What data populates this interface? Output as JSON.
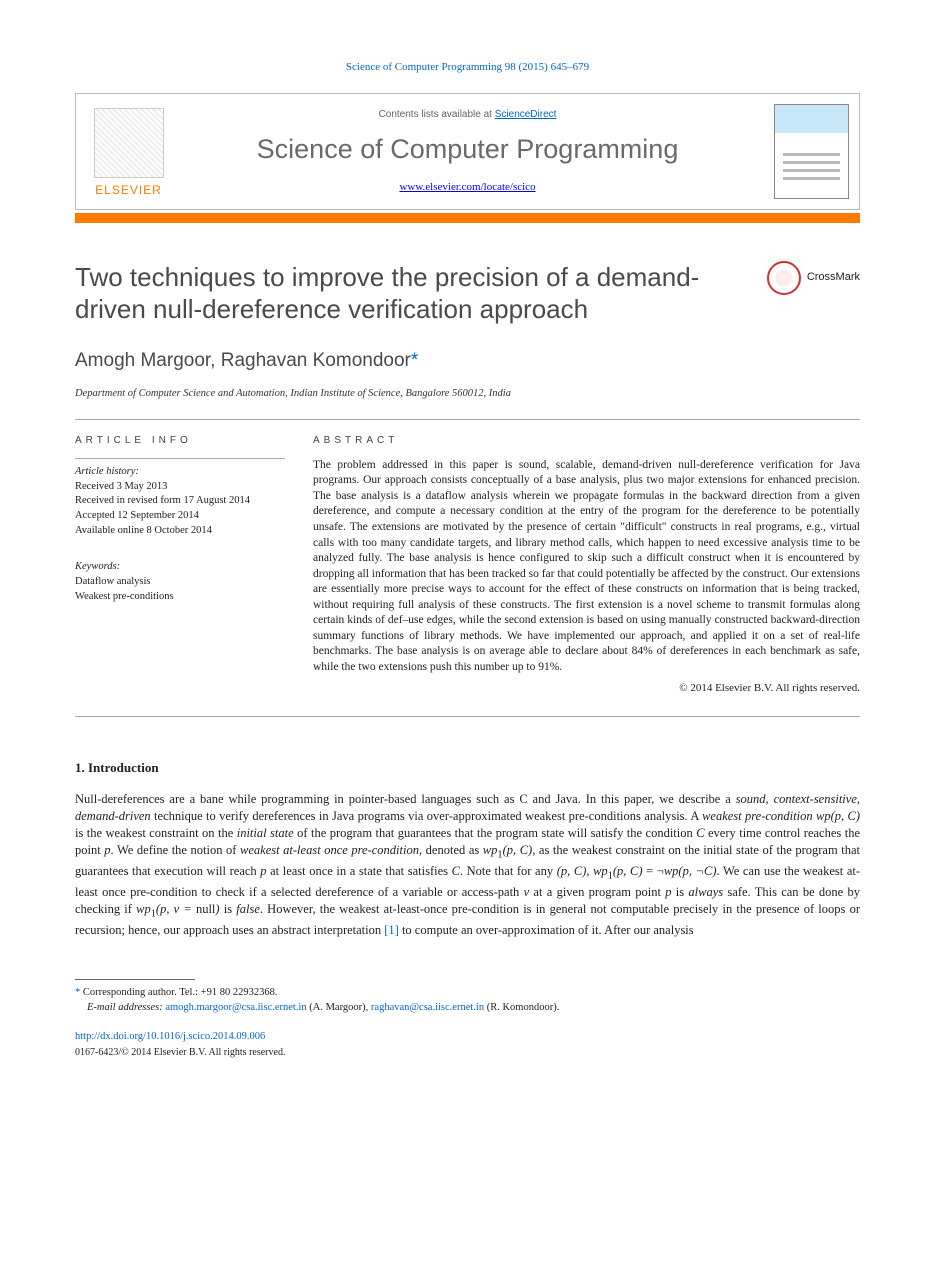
{
  "citation": "Science of Computer Programming 98 (2015) 645–679",
  "header": {
    "contents_line_pre": "Contents lists available at ",
    "contents_link": "ScienceDirect",
    "journal_name": "Science of Computer Programming",
    "journal_url": "www.elsevier.com/locate/scico",
    "publisher_word": "ELSEVIER"
  },
  "crossmark_label": "CrossMark",
  "title": "Two techniques to improve the precision of a demand-driven null-dereference verification approach",
  "authors": "Amogh Margoor, Raghavan Komondoor",
  "author_star": "*",
  "affiliation": "Department of Computer Science and Automation, Indian Institute of Science, Bangalore 560012, India",
  "article_info": {
    "heading": "ARTICLE INFO",
    "history_label": "Article history:",
    "received": "Received 3 May 2013",
    "revised": "Received in revised form 17 August 2014",
    "accepted": "Accepted 12 September 2014",
    "online": "Available online 8 October 2014",
    "keywords_label": "Keywords:",
    "kw1": "Dataflow analysis",
    "kw2": "Weakest pre-conditions"
  },
  "abstract": {
    "heading": "ABSTRACT",
    "text": "The problem addressed in this paper is sound, scalable, demand-driven null-dereference verification for Java programs. Our approach consists conceptually of a base analysis, plus two major extensions for enhanced precision. The base analysis is a dataflow analysis wherein we propagate formulas in the backward direction from a given dereference, and compute a necessary condition at the entry of the program for the dereference to be potentially unsafe. The extensions are motivated by the presence of certain \"difficult\" constructs in real programs, e.g., virtual calls with too many candidate targets, and library method calls, which happen to need excessive analysis time to be analyzed fully. The base analysis is hence configured to skip such a difficult construct when it is encountered by dropping all information that has been tracked so far that could potentially be affected by the construct. Our extensions are essentially more precise ways to account for the effect of these constructs on information that is being tracked, without requiring full analysis of these constructs. The first extension is a novel scheme to transmit formulas along certain kinds of def–use edges, while the second extension is based on using manually constructed backward-direction summary functions of library methods. We have implemented our approach, and applied it on a set of real-life benchmarks. The base analysis is on average able to declare about 84% of dereferences in each benchmark as safe, while the two extensions push this number up to 91%.",
    "copyright": "© 2014 Elsevier B.V. All rights reserved."
  },
  "section1": {
    "heading": "1. Introduction",
    "body_html": "Null-dereferences are a bane while programming in pointer-based languages such as C and Java. In this paper, we describe a <span class='ital'>sound, context-sensitive, demand-driven</span> technique to verify dereferences in Java programs via over-approximated weakest pre-conditions analysis. A <span class='ital'>weakest pre-condition wp(p, C)</span> is the weakest constraint on the <span class='ital'>initial state</span> of the program that guarantees that the program state will satisfy the condition <span class='ital'>C</span> every time control reaches the point <span class='ital'>p</span>. We define the notion of <span class='ital'>weakest at-least once pre-condition</span>, denoted as <span class='ital'>wp</span><sub>1</sub><span class='ital'>(p, C)</span>, as the weakest constraint on the initial state of the program that guarantees that execution will reach <span class='ital'>p</span> at least once in a state that satisfies <span class='ital'>C</span>. Note that for any <span class='ital'>(p, C)</span>, <span class='ital'>wp</span><sub>1</sub><span class='ital'>(p, C)</span> = ¬<span class='ital'>wp(p, ¬C)</span>. We can use the weakest at-least once pre-condition to check if a selected dereference of a variable or access-path <span class='ital'>v</span> at a given program point <span class='ital'>p</span> is <span class='ital'>always</span> safe. This can be done by checking if <span class='ital'>wp</span><sub>1</sub><span class='ital'>(p, v = </span>null<span class='ital'>)</span> is <span class='ital'>false</span>. However, the weakest at-least-once pre-condition is in general not computable precisely in the presence of loops or recursion; hence, our approach uses an abstract interpretation <a href='#'>[1]</a> to compute an over-approximation of it. After our analysis"
  },
  "footnotes": {
    "corresponding": "Corresponding author. Tel.: +91 80 22932368.",
    "email_label": "E-mail addresses:",
    "email1": "amogh.margoor@csa.iisc.ernet.in",
    "email1_who": "(A. Margoor),",
    "email2": "raghavan@csa.iisc.ernet.in",
    "email2_who": "(R. Komondoor)."
  },
  "doi": "http://dx.doi.org/10.1016/j.scico.2014.09.006",
  "final_copyright": "0167-6423/© 2014 Elsevier B.V. All rights reserved."
}
